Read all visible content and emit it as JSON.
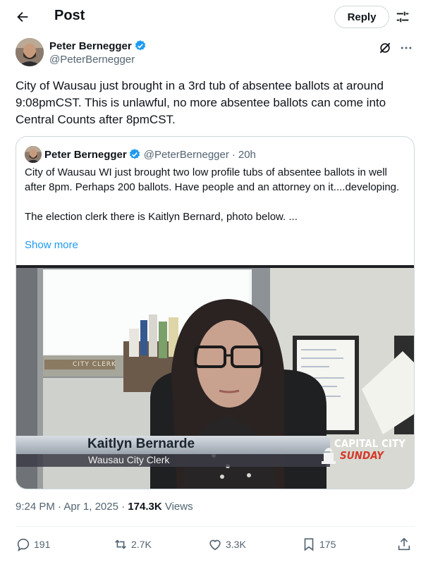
{
  "header": {
    "title": "Post",
    "reply_label": "Reply"
  },
  "author": {
    "name": "Peter Bernegger",
    "handle": "@PeterBernegger"
  },
  "tweet": {
    "text": "City of Wausau just brought in a 3rd tub of absentee ballots at around 9:08pmCST. This is unlawful, no more absentee ballots can come into Central Counts after 8pmCST."
  },
  "quote": {
    "name": "Peter Bernegger",
    "handle": "@PeterBernegger",
    "dot": "·",
    "time": "20h",
    "para1": "City of Wausau WI just brought two low profile tubs of absentee ballots in well after 8pm. Perhaps 200 ballots. Have people and an attorney on it....developing.",
    "para2": "The election clerk there is Kaitlyn Bernard, photo below. ...",
    "show_more": "Show more",
    "image": {
      "sign_text": "CITY CLERK",
      "lower_third_name": "Kaitlyn Bernarde",
      "lower_third_title": "Wausau City Clerk",
      "logo_line1": "CAPITAL CITY",
      "logo_line2": "SUNDAY"
    }
  },
  "meta": {
    "time": "9:24 PM",
    "sep1": " · ",
    "date": "Apr 1, 2025",
    "sep2": " · ",
    "views_count": "174.3K",
    "views_label": " Views"
  },
  "actions": {
    "replies": "191",
    "reposts": "2.7K",
    "likes": "3.3K",
    "bookmarks": "175"
  },
  "colors": {
    "accent": "#1d9bf0",
    "text": "#0f1419",
    "secondary": "#536471",
    "border": "#cfd9de"
  },
  "icons": [
    "back-arrow-icon",
    "adjust-icon",
    "verified-badge-icon",
    "grok-icon",
    "more-icon",
    "reply-icon",
    "repost-icon",
    "like-icon",
    "bookmark-icon",
    "share-icon"
  ]
}
